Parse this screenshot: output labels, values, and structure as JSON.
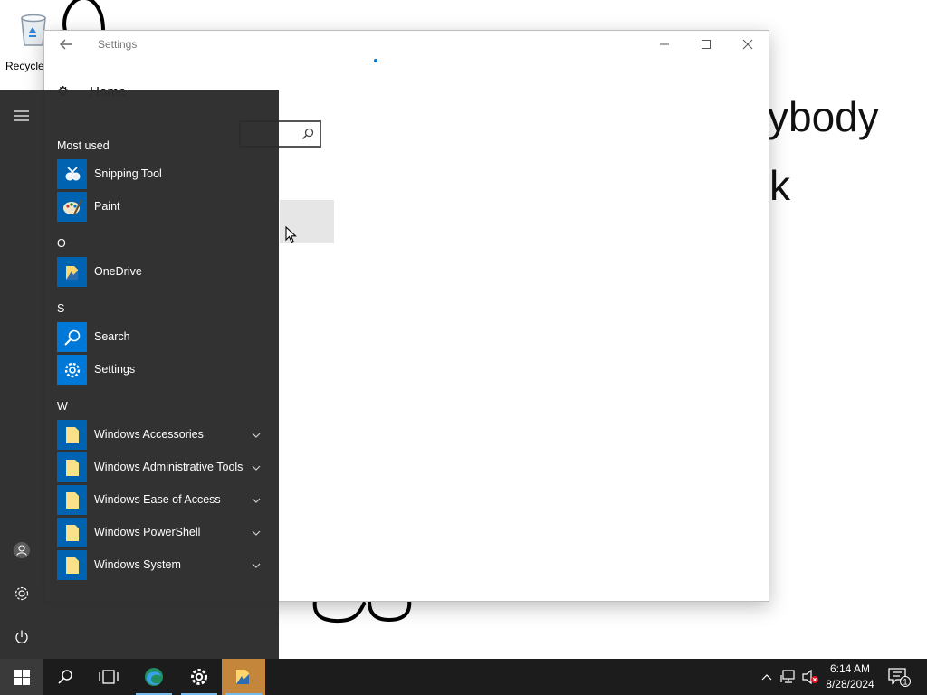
{
  "desktop": {
    "recycle_bin_label": "Recycle",
    "bg_text_line1": "ybody",
    "bg_text_line2": "k"
  },
  "settings_window": {
    "title": "Settings",
    "home_label": "Home",
    "controls": [
      "minimize",
      "maximize",
      "close"
    ]
  },
  "start_menu": {
    "sections": [
      {
        "header": "Most used",
        "items": [
          {
            "label": "Snipping Tool",
            "icon": "snipping-tool-icon",
            "expandable": false
          },
          {
            "label": "Paint",
            "icon": "paint-icon",
            "expandable": false
          }
        ]
      },
      {
        "header": "O",
        "items": [
          {
            "label": "OneDrive",
            "icon": "onedrive-icon",
            "expandable": false
          }
        ]
      },
      {
        "header": "S",
        "items": [
          {
            "label": "Search",
            "icon": "search-icon",
            "expandable": false
          },
          {
            "label": "Settings",
            "icon": "gear-icon",
            "expandable": false
          }
        ]
      },
      {
        "header": "W",
        "items": [
          {
            "label": "Windows Accessories",
            "icon": "folder-icon",
            "expandable": true
          },
          {
            "label": "Windows Administrative Tools",
            "icon": "folder-icon",
            "expandable": true
          },
          {
            "label": "Windows Ease of Access",
            "icon": "folder-icon",
            "expandable": true
          },
          {
            "label": "Windows PowerShell",
            "icon": "folder-icon",
            "expandable": true
          },
          {
            "label": "Windows System",
            "icon": "folder-icon",
            "expandable": true
          }
        ]
      }
    ],
    "rail": [
      "hamburger-menu-icon",
      "user-account-icon",
      "settings-gear-icon",
      "power-icon"
    ]
  },
  "taskbar": {
    "buttons": [
      "start-windows-icon",
      "search-icon",
      "task-view-icon",
      "edge-browser-icon",
      "settings-gear-icon",
      "file-explorer-icon"
    ],
    "clock_time": "6:14 AM",
    "clock_date": "8/28/2024",
    "notification_count": "1"
  },
  "colors": {
    "accent": "#0078d7",
    "tile_blue": "#0063b1",
    "start_bg": "#2b2b2b",
    "taskbar_bg": "#1c1c1c"
  }
}
